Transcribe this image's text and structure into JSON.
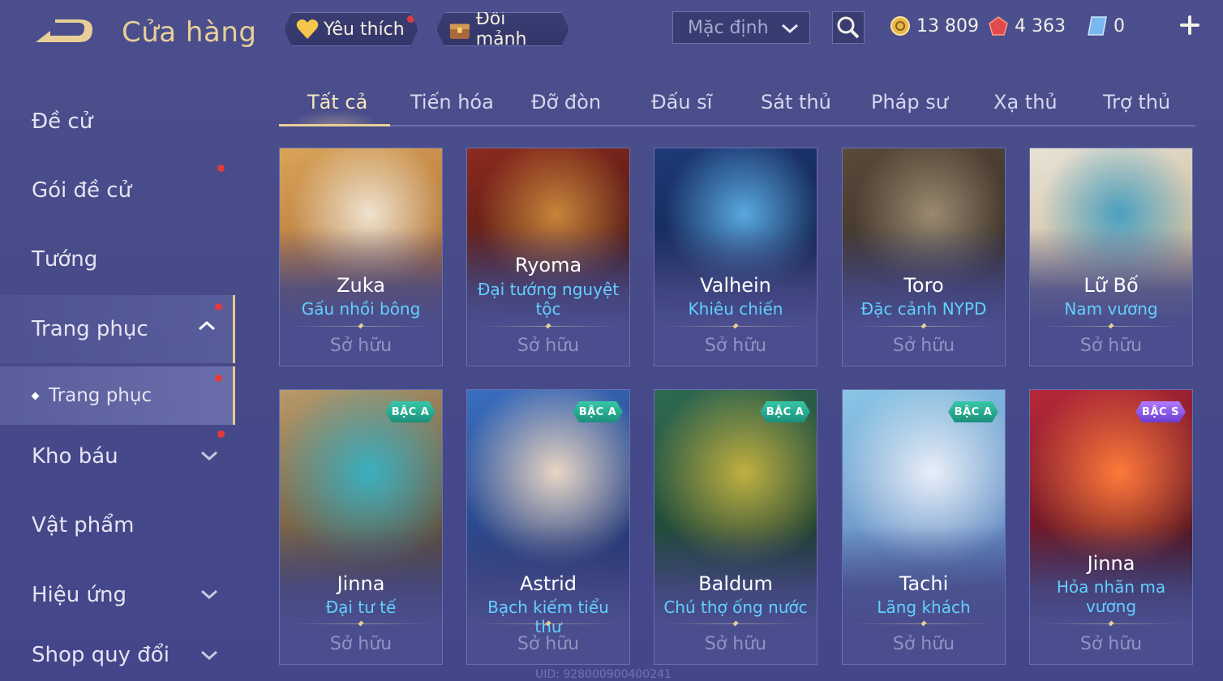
{
  "header": {
    "title": "Cửa hàng",
    "favorites_label": "Yêu thích",
    "exchange_label": "Đổi mảnh",
    "sort": {
      "value": "Mặc định"
    },
    "currencies": {
      "gold": "13 809",
      "gems": "4 363",
      "vouchers": "0"
    }
  },
  "sidebar": {
    "items": [
      {
        "label": "Đề cử"
      },
      {
        "label": "Gói đề cử"
      },
      {
        "label": "Tướng"
      },
      {
        "label": "Trang phục"
      },
      {
        "label": "Trang phục"
      },
      {
        "label": "Kho báu"
      },
      {
        "label": "Vật phẩm"
      },
      {
        "label": "Hiệu ứng"
      },
      {
        "label": "Shop quy đổi"
      }
    ]
  },
  "tabs": [
    "Tất cả",
    "Tiến hóa",
    "Đỡ đòn",
    "Đấu sĩ",
    "Sát thủ",
    "Pháp sư",
    "Xạ thủ",
    "Trợ thủ"
  ],
  "cards": [
    {
      "hero": "Zuka",
      "skin": "Gấu nhồi bông",
      "status": "Sở hữu",
      "badge": "",
      "art": [
        "#d9a45a",
        "#a6622a",
        "#efe3cf"
      ]
    },
    {
      "hero": "Ryoma",
      "skin": "Đại tướng nguyệt tộc",
      "status": "Sở hữu",
      "badge": "",
      "art": [
        "#8c2a1e",
        "#3a1414",
        "#c8843a"
      ]
    },
    {
      "hero": "Valhein",
      "skin": "Khiêu chiến",
      "status": "Sở hữu",
      "badge": "",
      "art": [
        "#1e3a78",
        "#0e1c3e",
        "#58a8e0"
      ]
    },
    {
      "hero": "Toro",
      "skin": "Đặc cảnh NYPD",
      "status": "Sở hữu",
      "badge": "",
      "art": [
        "#5a4a3a",
        "#2c2520",
        "#9a8a70"
      ]
    },
    {
      "hero": "Lữ Bố",
      "skin": "Nam vương",
      "status": "Sở hữu",
      "badge": "",
      "art": [
        "#e8e2d6",
        "#c8b28a",
        "#4aa0c0"
      ]
    },
    {
      "hero": "Jinna",
      "skin": "Đại tư tế",
      "status": "Sở hữu",
      "badge": "BẬC A",
      "art": [
        "#b89a6a",
        "#4a3c30",
        "#3ab0c0"
      ]
    },
    {
      "hero": "Astrid",
      "skin": "Bạch kiếm tiểu thư",
      "status": "Sở hữu",
      "badge": "BẬC A",
      "art": [
        "#3a6fc0",
        "#1e2c66",
        "#e8d6c4"
      ]
    },
    {
      "hero": "Baldum",
      "skin": "Chú thợ ống nước",
      "status": "Sở hữu",
      "badge": "BẬC A",
      "art": [
        "#2e6a52",
        "#183428",
        "#c0b040"
      ]
    },
    {
      "hero": "Tachi",
      "skin": "Lãng khách",
      "status": "Sở hữu",
      "badge": "BẬC A",
      "art": [
        "#8ac6e6",
        "#5a7cb8",
        "#e8eef8"
      ]
    },
    {
      "hero": "Jinna",
      "skin": "Hỏa nhãn ma vương",
      "status": "Sở hữu",
      "badge": "BẬC S",
      "art": [
        "#b8283a",
        "#3a0e1a",
        "#ff7a3a"
      ]
    }
  ],
  "footer": {
    "uid": "UID: 928000900400241"
  }
}
